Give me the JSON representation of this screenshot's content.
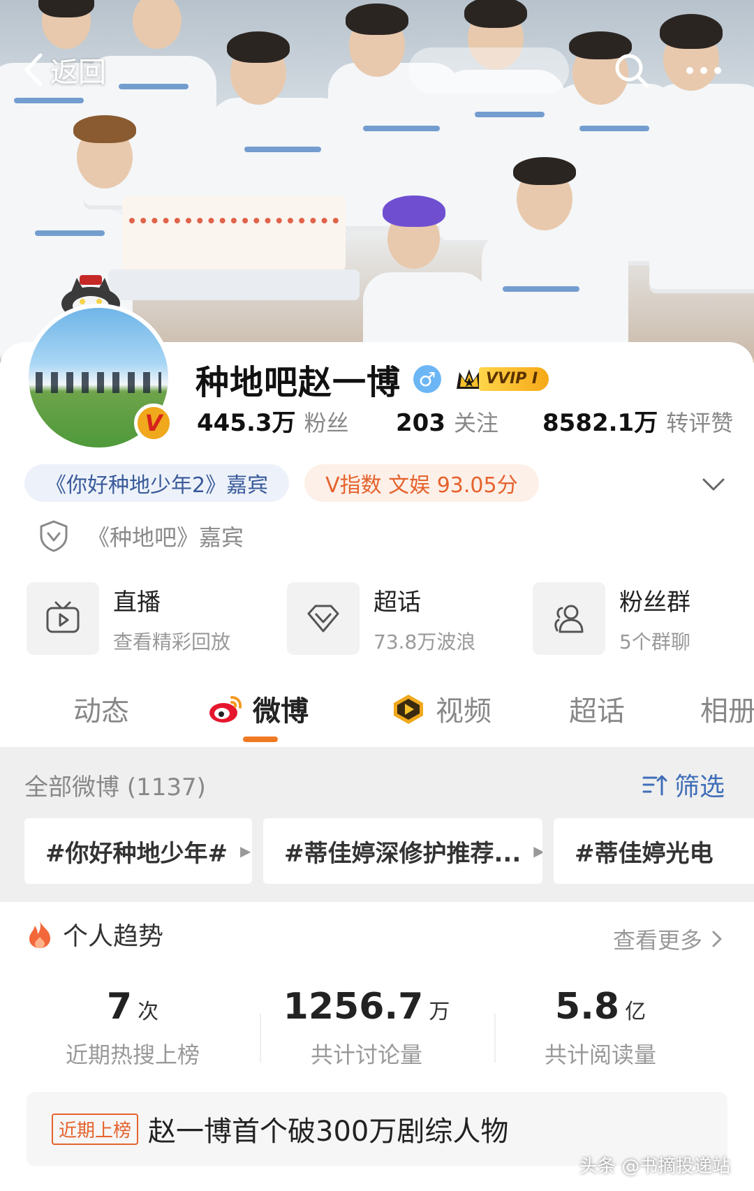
{
  "topbar": {
    "back_label": "返回"
  },
  "profile": {
    "name": "种地吧赵一博",
    "gender_symbol": "♂",
    "vip_label": "VVIP I",
    "verified_symbol": "V",
    "stats": [
      {
        "value": "445.3万",
        "label": "粉丝"
      },
      {
        "value": "203",
        "label": "关注"
      },
      {
        "value": "8582.1万",
        "label": "转评赞"
      }
    ],
    "tags": {
      "guest_tag": "《你好种地少年2》嘉宾",
      "v_index": "V指数 文娱 93.05分"
    },
    "verification_text": "《种地吧》嘉宾"
  },
  "features": [
    {
      "title": "直播",
      "subtitle": "查看精彩回放",
      "icon": "tv-play-icon"
    },
    {
      "title": "超话",
      "subtitle": "73.8万波浪",
      "icon": "diamond-icon"
    },
    {
      "title": "粉丝群",
      "subtitle": "5个群聊",
      "icon": "group-icon"
    }
  ],
  "tabs": [
    {
      "label": "动态"
    },
    {
      "label": "微博"
    },
    {
      "label": "视频"
    },
    {
      "label": "超话"
    },
    {
      "label": "相册"
    }
  ],
  "filter": {
    "header": "全部微博 (1137)",
    "button_label": "筛选",
    "topics": [
      "#你好种地少年#",
      "#蒂佳婷深修护推荐...",
      "#蒂佳婷光电"
    ]
  },
  "trends": {
    "header": "个人趋势",
    "more_label": "查看更多",
    "stats": [
      {
        "value": "7",
        "unit": "次",
        "caption": "近期热搜上榜"
      },
      {
        "value": "1256.7",
        "unit": "万",
        "caption": "共计讨论量"
      },
      {
        "value": "5.8",
        "unit": "亿",
        "caption": "共计阅读量"
      }
    ],
    "hot_tag": "近期上榜",
    "hot_text": "赵一博首个破300万剧综人物"
  },
  "watermark": "头条 @书摘投递站",
  "colors": {
    "accent_orange": "#f07a22",
    "link_blue": "#3f6eb8",
    "chip_orange": "#e5622c"
  }
}
